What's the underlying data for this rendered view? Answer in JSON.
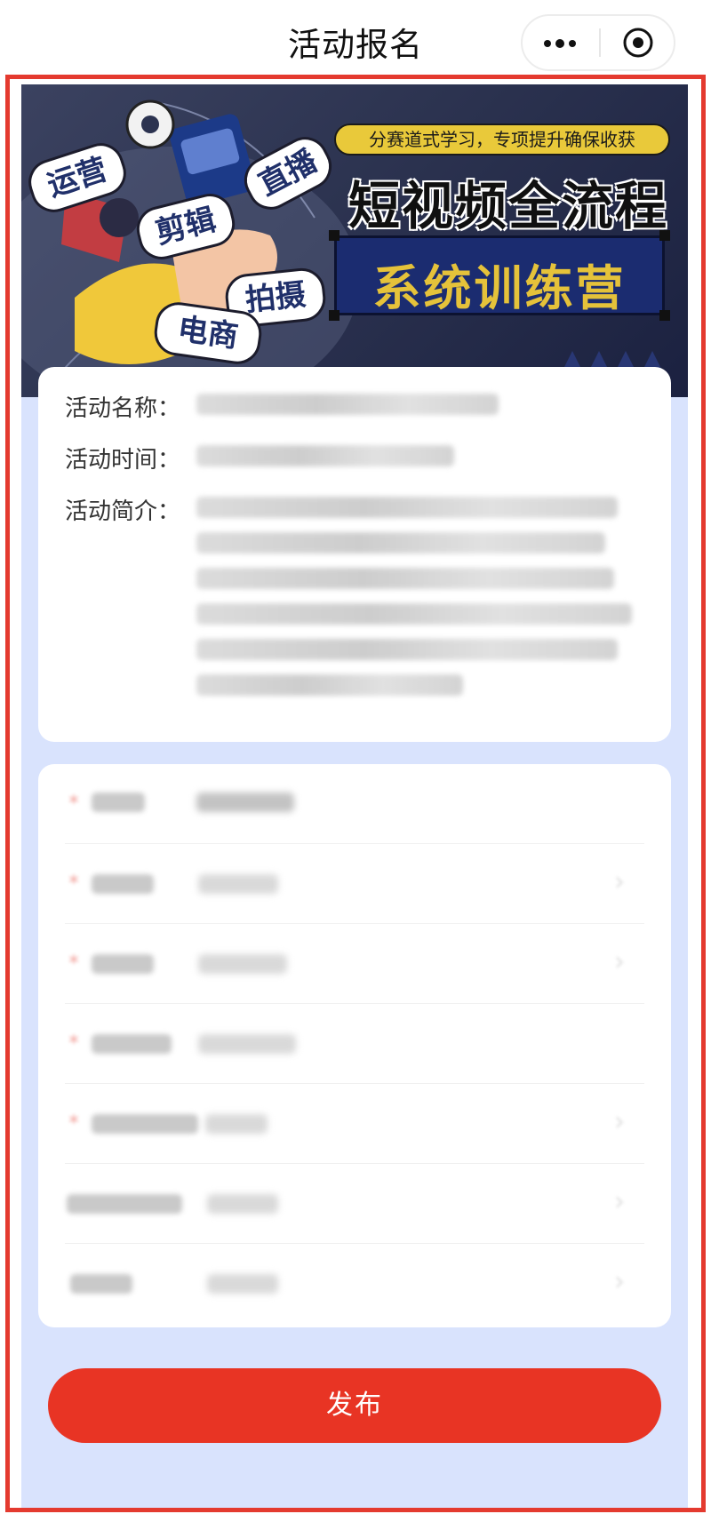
{
  "navbar": {
    "title": "活动报名",
    "menu_icon": "more-dots-icon",
    "target_icon": "target-circle-icon"
  },
  "banner": {
    "tagline": "分赛道式学习，专项提升确保收获",
    "title": "短视频全流程",
    "subtitle": "系统训练营",
    "stickers": [
      "运营",
      "剪辑",
      "直播",
      "拍摄",
      "电商"
    ]
  },
  "info": {
    "name_label": "活动名称：",
    "time_label": "活动时间：",
    "desc_label": "活动简介："
  },
  "submit": {
    "label": "发布"
  },
  "colors": {
    "accent": "#e83424",
    "frame": "#e43a2f",
    "background": "#d9e3fd",
    "banner_yellow": "#e9c93a",
    "banner_navy": "#1b2c70"
  }
}
